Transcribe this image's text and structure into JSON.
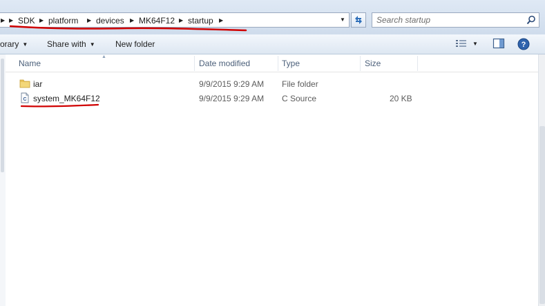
{
  "address_bar": {
    "breadcrumbs": [
      "SDK",
      "platform",
      "devices",
      "MK64F12",
      "startup"
    ]
  },
  "search": {
    "placeholder": "Search startup"
  },
  "toolbar": {
    "library_label": "orary",
    "share_with_label": "Share with",
    "new_folder_label": "New folder"
  },
  "columns": [
    "Name",
    "Date modified",
    "Type",
    "Size"
  ],
  "files": [
    {
      "name": "iar",
      "date_modified": "9/9/2015 9:29 AM",
      "type": "File folder",
      "size": "",
      "icon": "folder-icon"
    },
    {
      "name": "system_MK64F12",
      "date_modified": "9/9/2015 9:29 AM",
      "type": "C Source",
      "size": "20 KB",
      "icon": "c-source-file-icon"
    }
  ],
  "annotation_color": "#d00000",
  "icons": [
    "refresh-icon",
    "search-icon",
    "view-options-icon",
    "preview-pane-icon",
    "help-icon"
  ]
}
